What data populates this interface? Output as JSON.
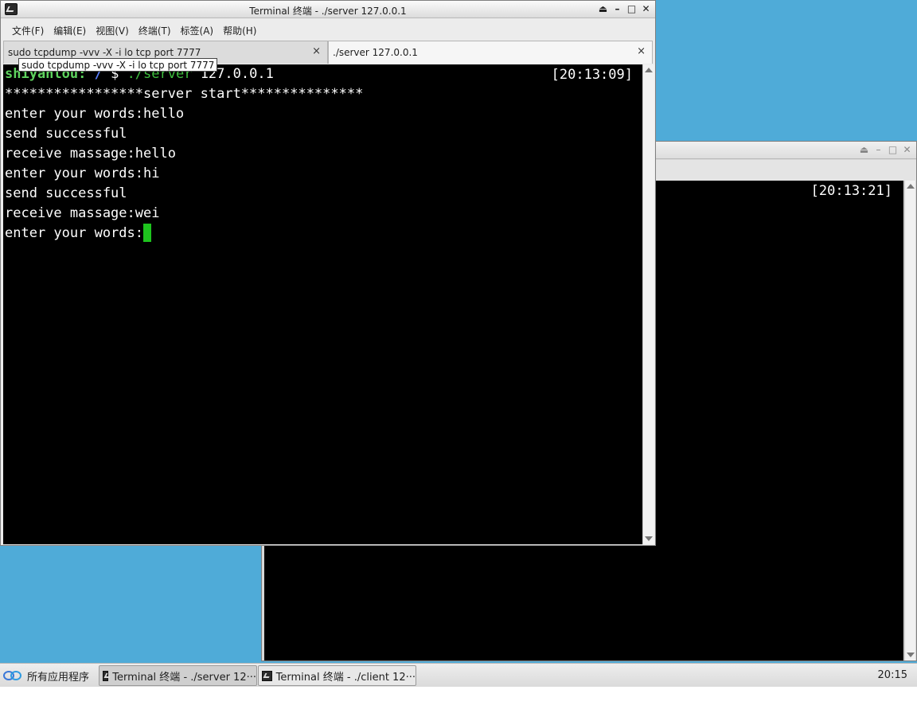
{
  "desktop": {
    "background_color": "#4fabd8"
  },
  "client_window": {
    "time": "[20:13:21]",
    "controls": [
      "shade-icon",
      "minimize-icon",
      "maximize-icon",
      "close-icon"
    ]
  },
  "server_window": {
    "title": "Terminal 终端 - ./server 127.0.0.1",
    "menu": [
      "文件(F)",
      "编辑(E)",
      "视图(V)",
      "终端(T)",
      "标签(A)",
      "帮助(H)"
    ],
    "tabs": [
      {
        "label": "sudo tcpdump -vvv -X -i lo tcp port 7777",
        "active": false
      },
      {
        "label": "./server 127.0.0.1",
        "active": true
      }
    ],
    "tab_close_glyph": "×",
    "tooltip": "sudo tcpdump -vvv -X -i lo tcp port 7777",
    "terminal": {
      "prompt_user": "shiyanlou:",
      "prompt_path": " / ",
      "prompt_symbol": "$ ",
      "command": "./server",
      "command_args": " 127.0.0.1",
      "time": "[20:13:09]",
      "lines": [
        "*****************server start***************",
        "enter your words:hello",
        "send successful",
        "receive massage:hello",
        "enter your words:hi",
        "send successful",
        "receive massage:wei"
      ],
      "current_input_prompt": "enter your words:"
    }
  },
  "taskbar": {
    "start_label": "所有应用程序",
    "tasks": [
      {
        "label": "Terminal 终端 - ./server 12···",
        "active": true
      },
      {
        "label": "Terminal 终端 - ./client 12···",
        "active": false
      }
    ],
    "clock": "20:15"
  },
  "colors": {
    "terminal_bg": "#000000",
    "cursor": "#1ec41e",
    "prompt_user": "#5ed35e",
    "prompt_path": "#5b7fff"
  }
}
